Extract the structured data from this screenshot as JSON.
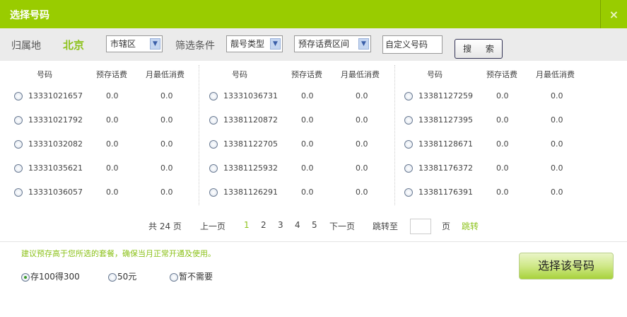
{
  "window": {
    "title": "选择号码",
    "close": "×"
  },
  "filter": {
    "region_label": "归属地",
    "city": "北京",
    "district": "市辖区",
    "filter_label": "筛选条件",
    "type": "靓号类型",
    "fee_range": "预存话费区间",
    "custom_number": "自定义号码",
    "search": "搜 索"
  },
  "headers": [
    "号码",
    "预存话费",
    "月最低消费"
  ],
  "groups": [
    [
      [
        "13331021657",
        "0.0",
        "0.0"
      ],
      [
        "13331021792",
        "0.0",
        "0.0"
      ],
      [
        "13331032082",
        "0.0",
        "0.0"
      ],
      [
        "13331035621",
        "0.0",
        "0.0"
      ],
      [
        "13331036057",
        "0.0",
        "0.0"
      ]
    ],
    [
      [
        "13331036731",
        "0.0",
        "0.0"
      ],
      [
        "13381120872",
        "0.0",
        "0.0"
      ],
      [
        "13381122705",
        "0.0",
        "0.0"
      ],
      [
        "13381125932",
        "0.0",
        "0.0"
      ],
      [
        "13381126291",
        "0.0",
        "0.0"
      ]
    ],
    [
      [
        "13381127259",
        "0.0",
        "0.0"
      ],
      [
        "13381127395",
        "0.0",
        "0.0"
      ],
      [
        "13381128671",
        "0.0",
        "0.0"
      ],
      [
        "13381176372",
        "0.0",
        "0.0"
      ],
      [
        "13381176391",
        "0.0",
        "0.0"
      ]
    ]
  ],
  "pager": {
    "total": "共 24 页",
    "prev": "上一页",
    "pages": [
      "1",
      "2",
      "3",
      "4",
      "5"
    ],
    "current": "1",
    "next": "下一页",
    "jump_to": "跳转至",
    "page_unit": "页",
    "go": "跳转"
  },
  "tip": "建议预存高于您所选的套餐，确保当月正常开通及使用。",
  "options": [
    {
      "label": "存100得300",
      "selected": true
    },
    {
      "label": "50元",
      "selected": false
    },
    {
      "label": "暂不需要",
      "selected": false
    }
  ],
  "confirm": "选择该号码",
  "colors": {
    "accent": "#99cc00",
    "link": "#8cc21a"
  }
}
